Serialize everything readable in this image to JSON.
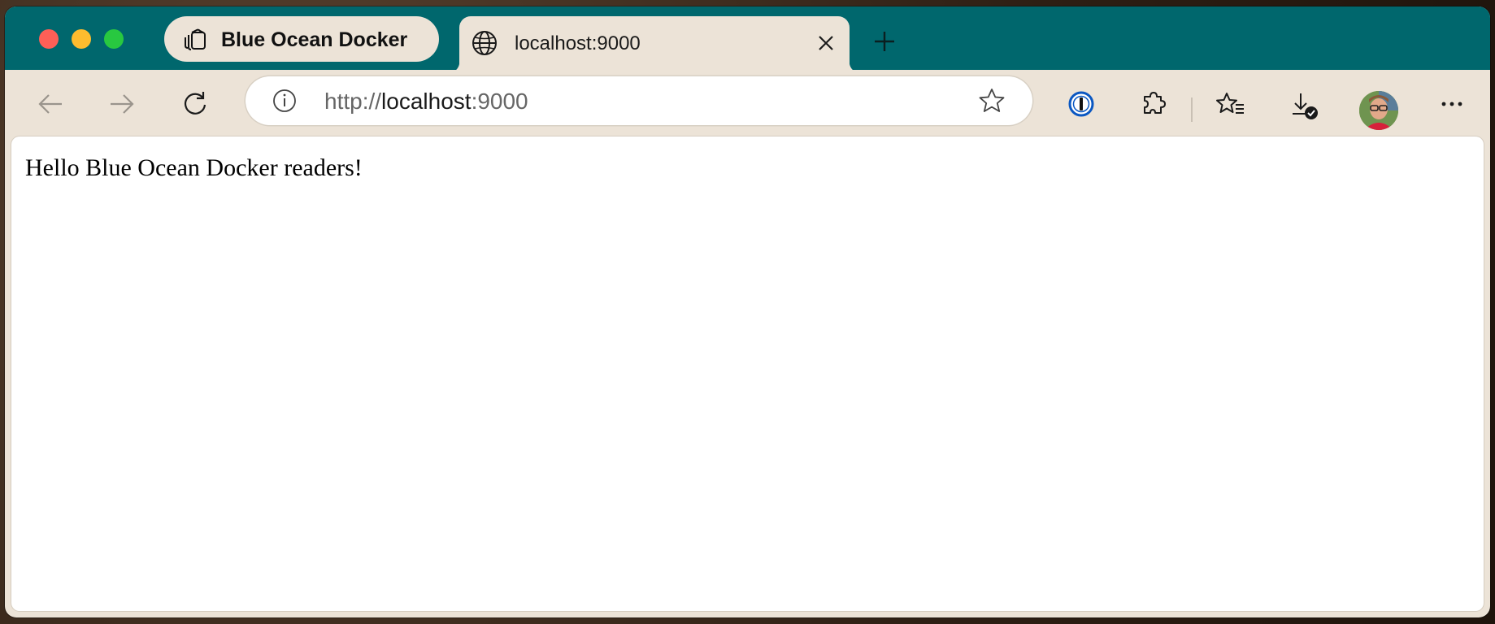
{
  "window": {
    "traffic_lights": [
      "close",
      "minimize",
      "zoom"
    ],
    "colors": {
      "titlebar": "#00676d",
      "chrome": "#ece3d7",
      "content": "#ffffff"
    }
  },
  "tabs": {
    "group_label": "Blue Ocean Docker",
    "active_tab_label": "localhost:9000",
    "active_tab_icon": "globe-icon"
  },
  "addressbar": {
    "url_scheme": "http://",
    "url_host": "localhost",
    "url_port": ":9000"
  },
  "toolbar": {
    "icons": [
      "back-icon",
      "forward-icon",
      "reload-icon",
      "password-manager-icon",
      "extensions-icon",
      "favorites-icon",
      "downloads-icon",
      "avatar",
      "more-icon"
    ]
  },
  "page": {
    "body_text": "Hello Blue Ocean Docker readers!"
  }
}
